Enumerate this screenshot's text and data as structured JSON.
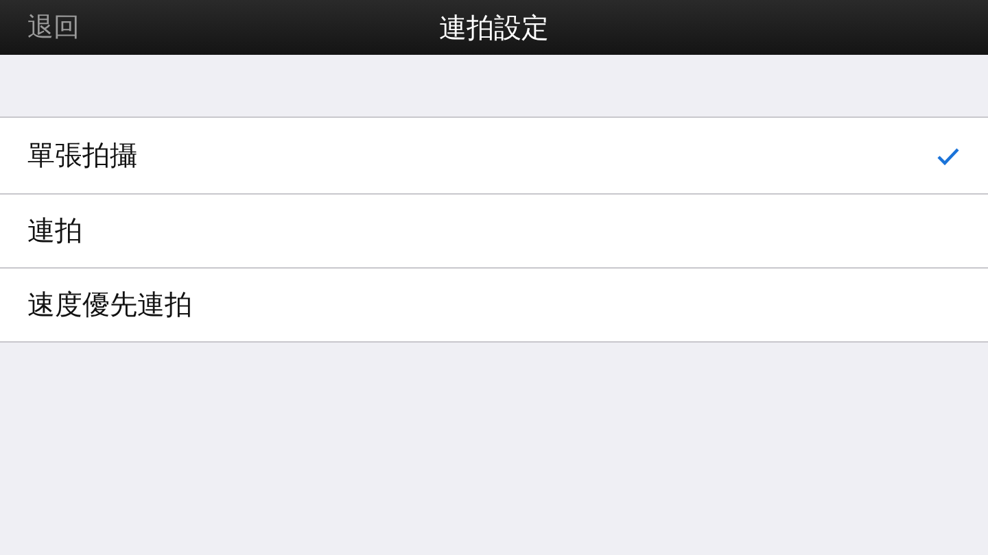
{
  "nav_bar": {
    "back": "退回",
    "title": "連拍設定"
  },
  "options": [
    {
      "label": "單張拍攝",
      "selected": true
    },
    {
      "label": "連拍",
      "selected": false
    },
    {
      "label": "速度優先連拍",
      "selected": false
    }
  ]
}
